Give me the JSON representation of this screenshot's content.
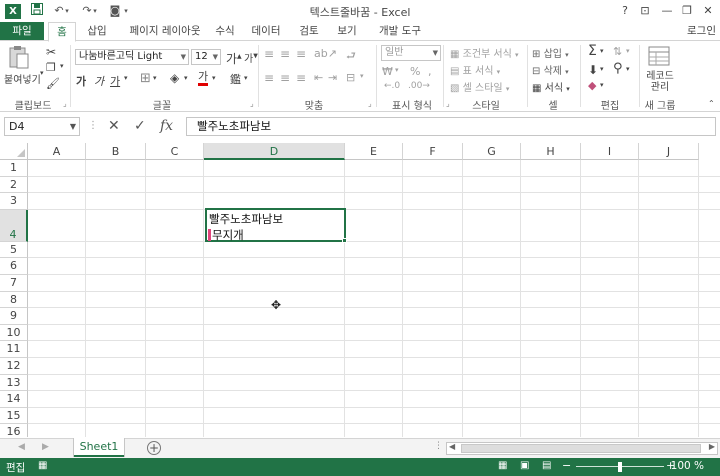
{
  "window": {
    "title": "텍스트줄바꿈 - Excel",
    "logo": "X",
    "controls": {
      "help": "?",
      "ribbon_options": "⊡",
      "minimize": "—",
      "restore": "❐",
      "close": "✕"
    }
  },
  "tabs": {
    "file": "파일",
    "items": [
      "홈",
      "삽입",
      "페이지 레이아웃",
      "수식",
      "데이터",
      "검토",
      "보기",
      "개발 도구"
    ],
    "active": "홈",
    "user": "로그인"
  },
  "ribbon": {
    "clipboard": {
      "label": "클립보드",
      "paste": "붙여넣기"
    },
    "font": {
      "label": "글꼴",
      "font_name": "나눔바른고딕 Light",
      "font_size": "12"
    },
    "alignment": {
      "label": "맞춤"
    },
    "number": {
      "label": "표시 형식",
      "format": "일반"
    },
    "styles": {
      "label": "스타일",
      "conditional": "조건부 서식",
      "as_table": "표 서식",
      "cell_styles": "셀 스타일"
    },
    "cells": {
      "label": "셀",
      "insert": "삽입",
      "delete": "삭제",
      "format": "서식"
    },
    "editing": {
      "label": "편집"
    },
    "new_group": {
      "label": "새 그룹",
      "record_macro": "레코드",
      "record_macro_line2": "관리"
    }
  },
  "formula_bar": {
    "name_box": "D4",
    "formula": "빨주노초파남보"
  },
  "grid": {
    "columns": [
      "A",
      "B",
      "C",
      "D",
      "E",
      "F",
      "G",
      "H",
      "I",
      "J"
    ],
    "rows": [
      "1",
      "2",
      "3",
      "4",
      "5",
      "6",
      "7",
      "8",
      "9",
      "10",
      "11",
      "12",
      "13",
      "14",
      "15",
      "16"
    ],
    "selected_column": "D",
    "selected_row": "4",
    "active_cell": {
      "line1": "빨주노초파남보",
      "line2": "무지개"
    }
  },
  "sheets": {
    "tabs": [
      "Sheet1"
    ],
    "active": "Sheet1"
  },
  "status": {
    "mode": "편집",
    "zoom": "100 %"
  },
  "colors": {
    "accent": "#217346",
    "caret": "#e0457b"
  }
}
